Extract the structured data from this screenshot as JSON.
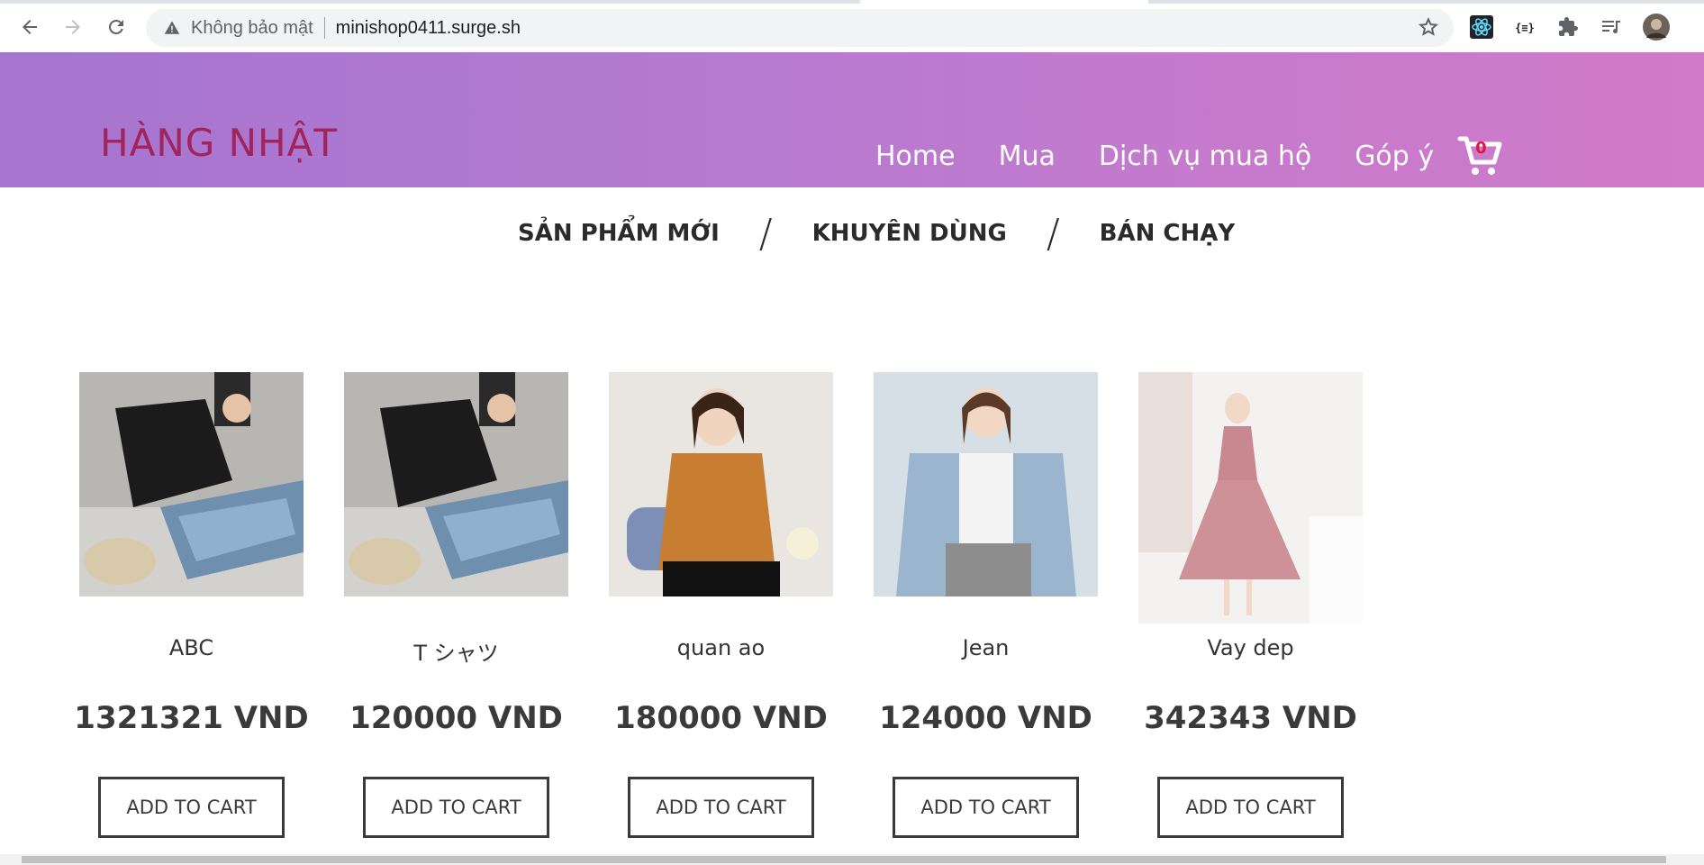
{
  "browser": {
    "security_label": "Không bảo mật",
    "url": "minishop0411.surge.sh",
    "icons": [
      "back-arrow-icon",
      "forward-arrow-icon",
      "reload-icon",
      "warning-icon",
      "star-icon",
      "react-devtools-icon",
      "json-viewer-icon",
      "extensions-puzzle-icon",
      "media-playlist-icon",
      "profile-avatar"
    ]
  },
  "header": {
    "logo": "HÀNG NHẬT",
    "nav": [
      "Home",
      "Mua",
      "Dịch vụ mua hộ",
      "Góp ý"
    ],
    "cart_count": "0",
    "colors": {
      "gradient_start": "#a575cf",
      "gradient_end": "#d07ac8",
      "logo": "#a1245c",
      "cart_count": "#e0163a"
    }
  },
  "category_tabs": {
    "items": [
      "SẢN PHẨM MỚI",
      "KHUYÊN DÙNG",
      "BÁN CHẠY"
    ],
    "separator": "/"
  },
  "products": [
    {
      "name": "ABC",
      "price": "1321321 VND",
      "button": "ADD TO CART",
      "image": "black-shirt-jeans-cap-photo"
    },
    {
      "name": "T シャツ",
      "price": "120000 VND",
      "button": "ADD TO CART",
      "image": "black-shirt-jeans-cap-photo"
    },
    {
      "name": "quan ao",
      "price": "180000 VND",
      "button": "ADD TO CART",
      "image": "orange-knit-sweater-photo"
    },
    {
      "name": "Jean",
      "price": "124000 VND",
      "button": "ADD TO CART",
      "image": "denim-jacket-photo"
    },
    {
      "name": "Vay dep",
      "price": "342343 VND",
      "button": "ADD TO CART",
      "image": "pink-dress-photo"
    }
  ]
}
